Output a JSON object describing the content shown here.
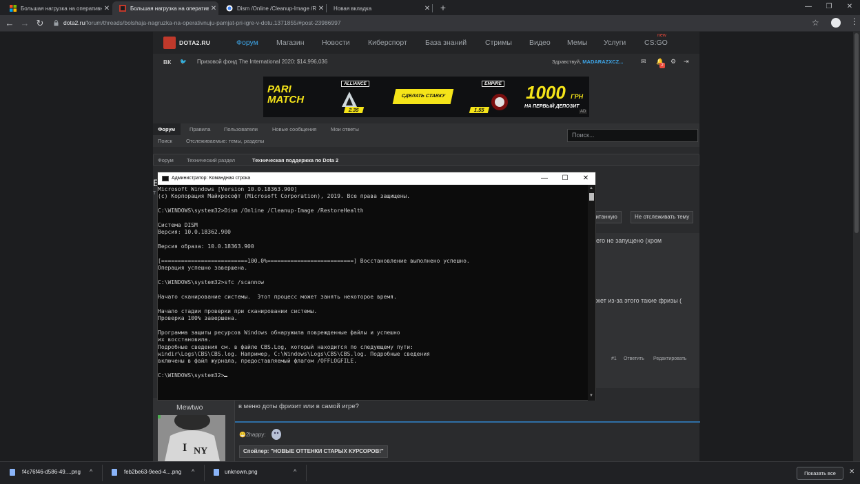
{
  "browser": {
    "tabs": [
      {
        "title": "Большая нагрузка на оперативн..."
      },
      {
        "title": "Большая нагрузка на оперативн..."
      },
      {
        "title": "Dism /Online /Cleanup-Image /R..."
      },
      {
        "title": "Новая вкладка"
      }
    ],
    "url_host": "dota2.ru",
    "url_path": "/forum/threads/bolshaja-nagruzka-na-operativnuju-pamjat-pri-igre-v-dotu.1371855/#post-23986997"
  },
  "site": {
    "logo_text": "DOTA2.RU",
    "nav": [
      "Форум",
      "Магазин",
      "Новости",
      "Киберспорт",
      "База знаний",
      "Стримы",
      "Видео",
      "Мемы",
      "Услуги",
      "CS:GO"
    ],
    "new_badge": "new",
    "social": [
      "ВК",
      "🐦"
    ],
    "prize": "Призовой фонд The International 2020: $14,996,036",
    "greeting": "Здравствуй,",
    "username": "MADARAZXCZ...",
    "notif_count": "2"
  },
  "banner": {
    "brand_line1": "PARI",
    "brand_line2": "MATCH",
    "team1": "ALLIANCE",
    "odds1": "2.35",
    "cta": "СДЕЛАТЬ СТАВКУ",
    "team2": "EMPIRE",
    "odds2": "1.55",
    "bonus": "1000",
    "bonus_unit": "ГРН",
    "bonus_sub": "НА ПЕРВЫЙ ДЕПОЗИТ",
    "ad_tag": "AD"
  },
  "forum_nav": {
    "row1": [
      "Форум",
      "Правила",
      "Пользователи",
      "Новые сообщения",
      "Мои ответы"
    ],
    "row2": [
      "Поиск",
      "Отслеживаемые: темы, разделы"
    ],
    "search_placeholder": "Поиск..."
  },
  "breadcrumbs": [
    "Форум",
    "Технический раздел",
    "Техническая поддержка по Dota 2"
  ],
  "thread": {
    "title_initial": "Б",
    "subtitle_initial": "Т",
    "btn_read": "очитанную",
    "btn_untrack": "Не отслеживать тему",
    "post1_line1": "его не запущено (хром",
    "post1_line2": "жет из-за этого такие фризы (",
    "post1_num": "#1",
    "post1_reply": "Ответить",
    "post1_edit": "Редактировать"
  },
  "post2": {
    "author": "Mewtwo",
    "text": "в меню доты фризит или в самой игре?",
    "sig": "2happy:",
    "spoiler": "Спойлер: \"НОВЫЕ ОТТЕНКИ СТАРЫХ КУРСОРОВ!\""
  },
  "cmd": {
    "title": "Администратор: Командная строка",
    "lines": [
      "Microsoft Windows [Version 10.0.18363.900]",
      "(c) Корпорация Майкрософт (Microsoft Corporation), 2019. Все права защищены.",
      "",
      "C:\\WINDOWS\\system32>Dism /Online /Cleanup-Image /RestoreHealth",
      "",
      "Cистема DISM",
      "Версия: 10.0.18362.900",
      "",
      "Версия образа: 10.0.18363.900",
      "",
      "[==========================100.0%==========================] Восстановление выполнено успешно.",
      "Операция успешно завершена.",
      "",
      "C:\\WINDOWS\\system32>sfc /scannow",
      "",
      "Начато сканирование системы.  Этот процесс может занять некоторое время.",
      "",
      "Начало стадии проверки при сканировании системы.",
      "Проверка 100% завершена.",
      "",
      "Программа защиты ресурсов Windows обнаружила поврежденные файлы и успешно",
      "их восстановила.",
      "Подробные сведения см. в файле CBS.Log, который находится по следующему пути:",
      "windir\\Logs\\CBS\\CBS.log. Например, C:\\Windows\\Logs\\CBS\\CBS.log. Подробные сведения",
      "включены в файл журнала, предоставляемый флагом /OFFLOGFILE.",
      ""
    ],
    "prompt": "C:\\WINDOWS\\system32>"
  },
  "downloads": {
    "items": [
      "f4c76f46-d586-49....png",
      "feb2be63-9eed-4....png",
      "unknown.png"
    ],
    "show_all": "Показать все"
  },
  "colors": {
    "accent": "#3ea6e8",
    "brand_yellow": "#f5e419",
    "alert": "#e84a3c"
  }
}
